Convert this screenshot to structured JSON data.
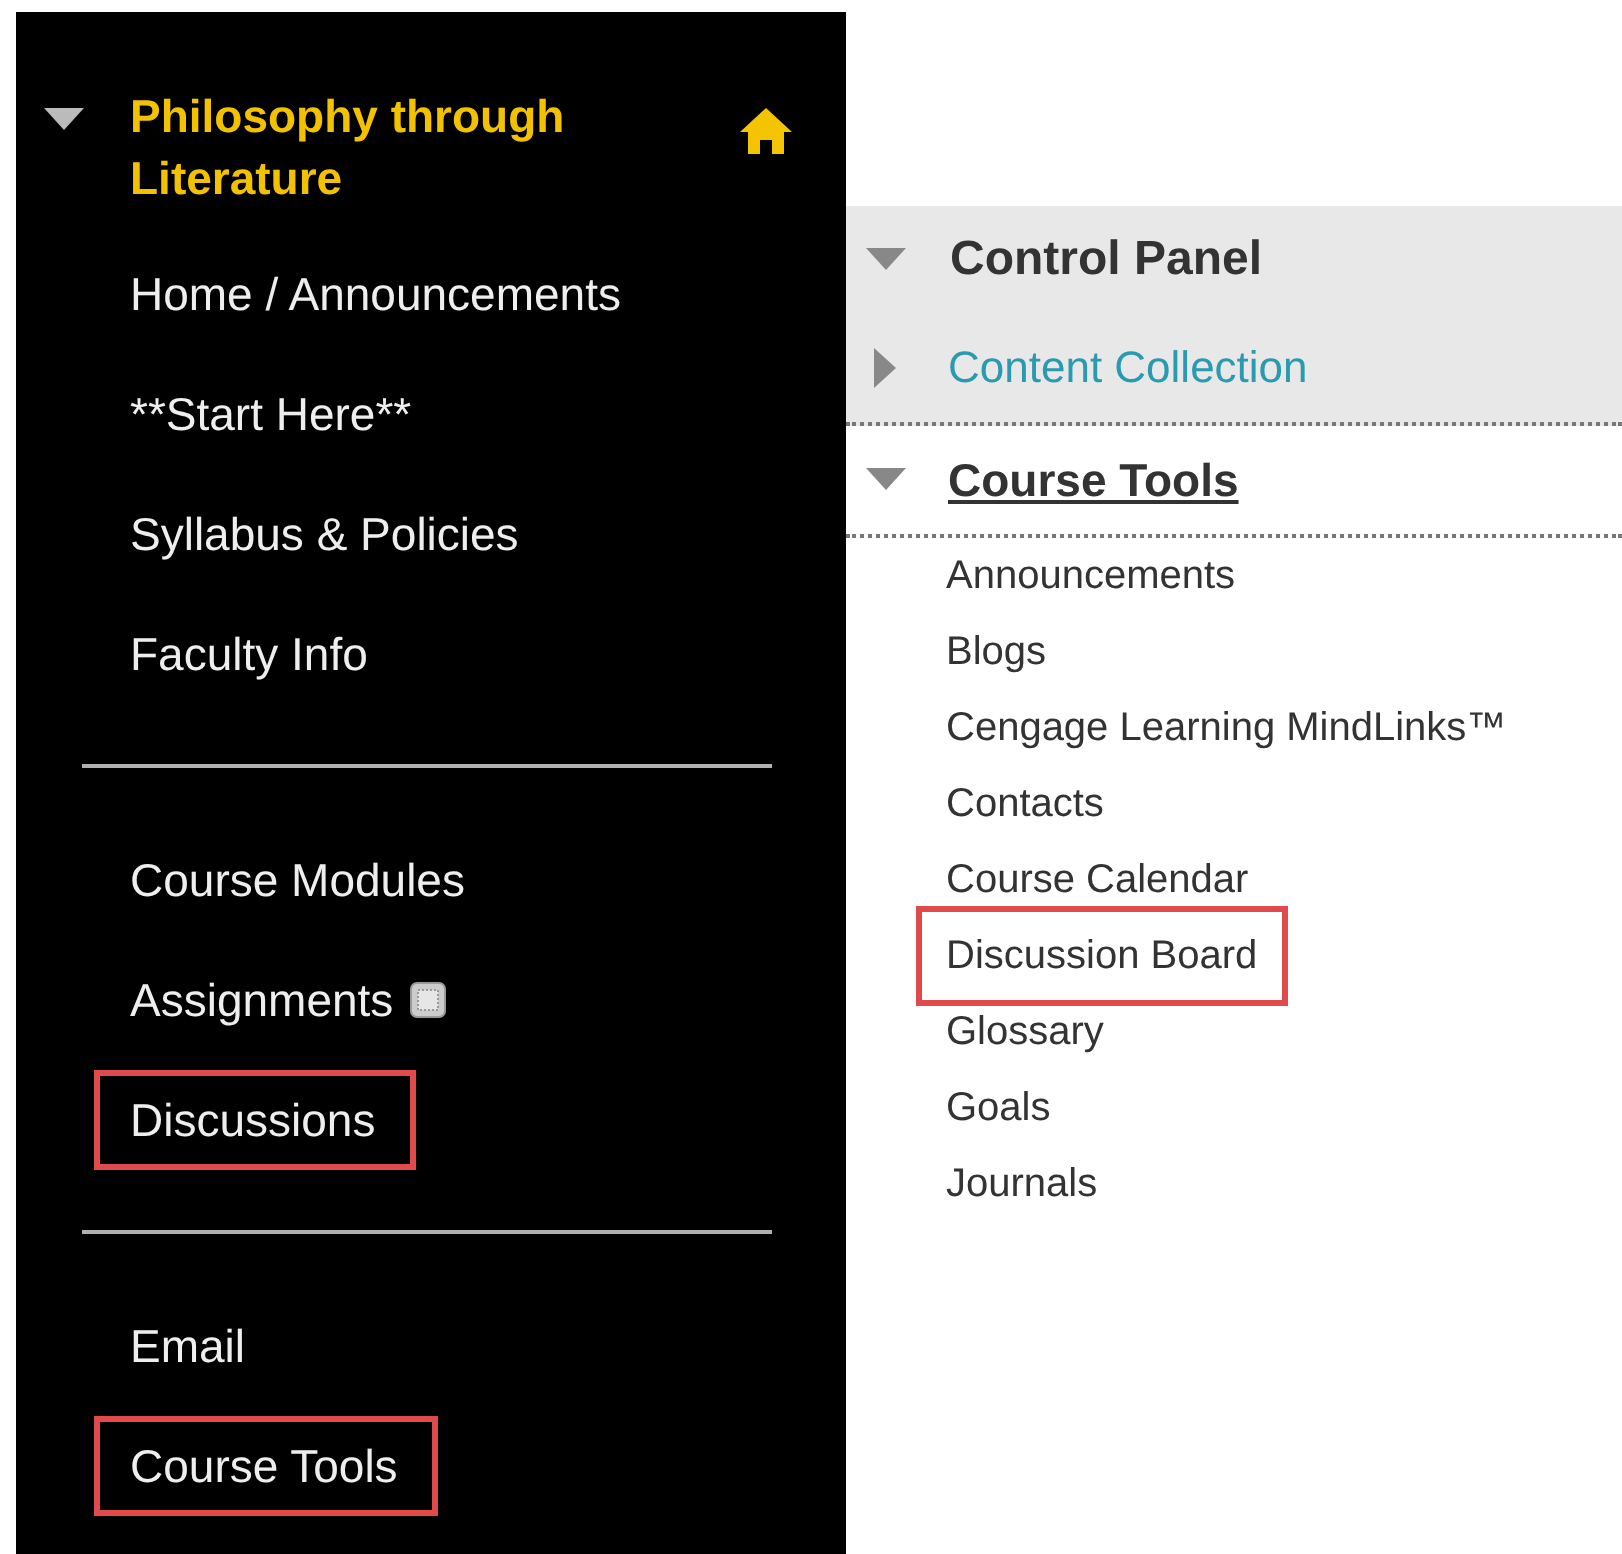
{
  "course_menu": {
    "title": "Philosophy through Literature",
    "expanded": true,
    "groups": [
      [
        {
          "label": "Home / Announcements",
          "highlighted": false,
          "badge": false
        },
        {
          "label": "**Start Here**",
          "highlighted": false,
          "badge": false
        },
        {
          "label": "Syllabus & Policies",
          "highlighted": false,
          "badge": false
        },
        {
          "label": "Faculty Info",
          "highlighted": false,
          "badge": false
        }
      ],
      [
        {
          "label": "Course Modules",
          "highlighted": false,
          "badge": false
        },
        {
          "label": "Assignments",
          "highlighted": false,
          "badge": true
        },
        {
          "label": "Discussions",
          "highlighted": true,
          "badge": false
        }
      ],
      [
        {
          "label": "Email",
          "highlighted": false,
          "badge": false
        },
        {
          "label": "Course Tools",
          "highlighted": true,
          "badge": false
        }
      ]
    ]
  },
  "control_panel": {
    "title": "Control Panel",
    "expanded": true,
    "sections": [
      {
        "label": "Content Collection",
        "expanded": false
      },
      {
        "label": "Course Tools",
        "expanded": true,
        "items": [
          {
            "label": "Announcements",
            "highlighted": false
          },
          {
            "label": "Blogs",
            "highlighted": false
          },
          {
            "label": "Cengage Learning MindLinks™",
            "highlighted": false
          },
          {
            "label": "Contacts",
            "highlighted": false
          },
          {
            "label": "Course Calendar",
            "highlighted": false
          },
          {
            "label": "Discussion Board",
            "highlighted": true
          },
          {
            "label": "Glossary",
            "highlighted": false
          },
          {
            "label": "Goals",
            "highlighted": false
          },
          {
            "label": "Journals",
            "highlighted": false
          }
        ]
      }
    ]
  }
}
